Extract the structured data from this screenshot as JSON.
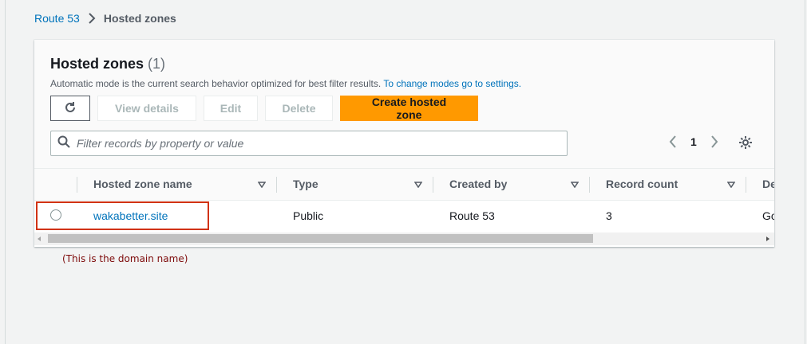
{
  "breadcrumb": {
    "items": [
      "Route 53",
      "Hosted zones"
    ]
  },
  "panel": {
    "title": "Hosted zones",
    "count": "(1)",
    "description": "Automatic mode is the current search behavior optimized for best filter results.",
    "description_link": "To change modes go to settings."
  },
  "toolbar": {
    "view_details": "View details",
    "edit": "Edit",
    "delete": "Delete",
    "create": "Create hosted zone"
  },
  "filter": {
    "placeholder": "Filter records by property or value"
  },
  "pagination": {
    "page": "1"
  },
  "table": {
    "columns": [
      "Hosted zone name",
      "Type",
      "Created by",
      "Record count",
      "De"
    ],
    "rows": [
      {
        "name": "wakabetter.site",
        "type": "Public",
        "created_by": "Route 53",
        "record_count": "3",
        "description": "Go"
      }
    ]
  },
  "annotation": "(This is the domain name)",
  "colors": {
    "link": "#0073bb",
    "primary_button": "#ff9900",
    "highlight": "#d13212",
    "annotation_text": "#7d0a0a"
  },
  "icons": {
    "refresh": "refresh-icon",
    "search": "search-icon",
    "sort": "sort-caret-icon",
    "prev": "chevron-left-icon",
    "next": "chevron-right-icon",
    "settings": "gear-icon"
  }
}
